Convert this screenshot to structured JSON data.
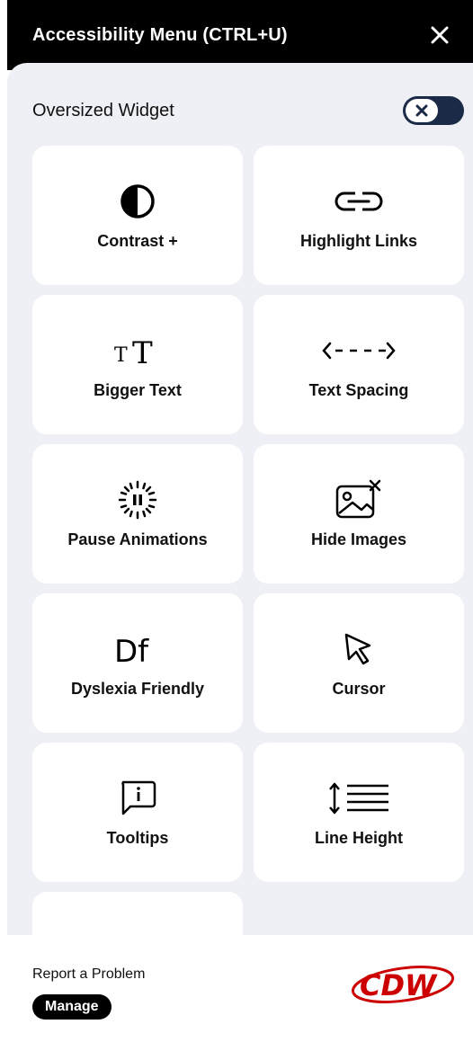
{
  "header": {
    "title": "Accessibility Menu (CTRL+U)"
  },
  "oversized_widget": {
    "label": "Oversized Widget",
    "toggle_state": "off"
  },
  "tiles": [
    {
      "label": "Contrast +",
      "icon": "contrast-icon"
    },
    {
      "label": "Highlight Links",
      "icon": "link-icon"
    },
    {
      "label": "Bigger Text",
      "icon": "text-size-icon"
    },
    {
      "label": "Text Spacing",
      "icon": "text-spacing-icon"
    },
    {
      "label": "Pause Animations",
      "icon": "pause-animations-icon"
    },
    {
      "label": "Hide Images",
      "icon": "hide-images-icon"
    },
    {
      "label": "Dyslexia Friendly",
      "icon": "dyslexia-icon"
    },
    {
      "label": "Cursor",
      "icon": "cursor-icon"
    },
    {
      "label": "Tooltips",
      "icon": "tooltip-icon"
    },
    {
      "label": "Line Height",
      "icon": "line-height-icon"
    }
  ],
  "footer": {
    "report_label": "Report a Problem",
    "manage_label": "Manage",
    "logo_text": "CDW"
  },
  "colors": {
    "header_bg": "#000000",
    "panel_bg": "#eef0f5",
    "toggle_bg": "#1b2a47",
    "logo_red": "#cc0000"
  }
}
